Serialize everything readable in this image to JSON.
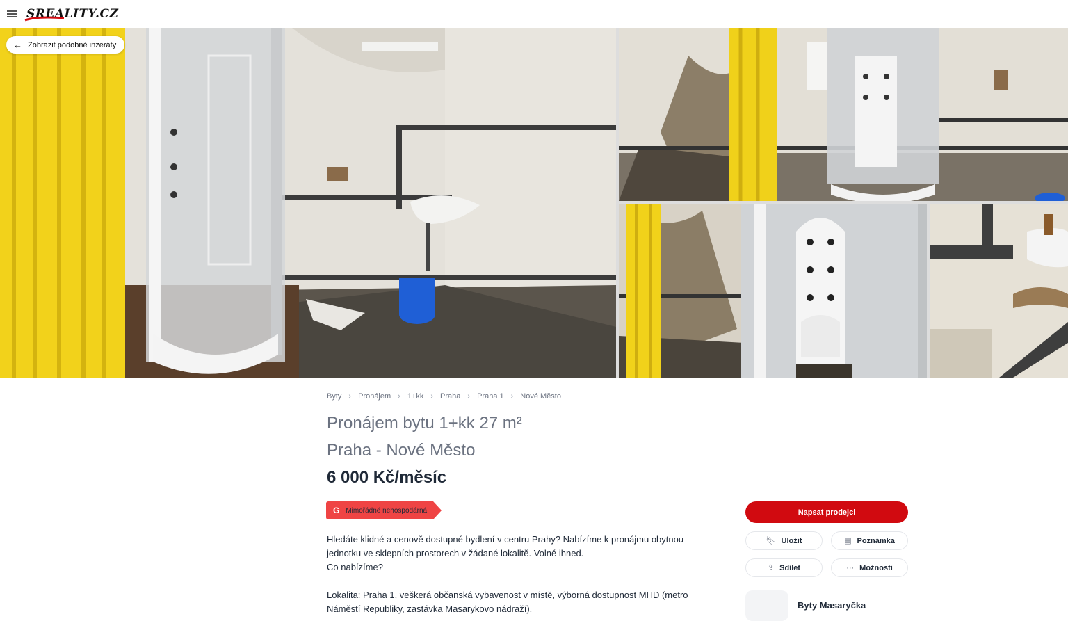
{
  "header": {
    "logo_text": "SREALITY.CZ",
    "menu_icon": "hamburger-icon"
  },
  "gallery": {
    "similar_label": "Zobrazit podobné inzeráty"
  },
  "breadcrumb": [
    {
      "label": "Byty"
    },
    {
      "label": "Pronájem"
    },
    {
      "label": "1+kk"
    },
    {
      "label": "Praha"
    },
    {
      "label": "Praha 1"
    },
    {
      "label": "Nové Město"
    }
  ],
  "listing": {
    "title_line1": "Pronájem bytu 1+kk 27 m²",
    "title_line2": "Praha - Nové Město",
    "price": "6 000 Kč/měsíc",
    "energy_grade": "G",
    "energy_label": "Mimořádně nehospodárná",
    "description": {
      "p1": "Hledáte klidné a cenově dostupné bydlení v centru Prahy? Nabízíme k pronájmu obytnou",
      "p2": "jednotku ve sklepních prostorech v žádané lokalitě. Volné ihned.",
      "p3": "Co nabízíme?",
      "p4": "Lokalita: Praha 1, veškerá občanská vybavenost v místě, výborná dostupnost MHD (metro",
      "p5": "Náměstí Republiky, zastávka Masarykovo nádraží)."
    }
  },
  "actions": {
    "contact_label": "Napsat prodejci",
    "save_label": "Uložit",
    "note_label": "Poznámka",
    "share_label": "Sdílet",
    "more_label": "Možnosti"
  },
  "seller": {
    "name": "Byty Masaryčka"
  },
  "colors": {
    "brand_red": "#d10a10",
    "energy_red": "#ef4444"
  }
}
